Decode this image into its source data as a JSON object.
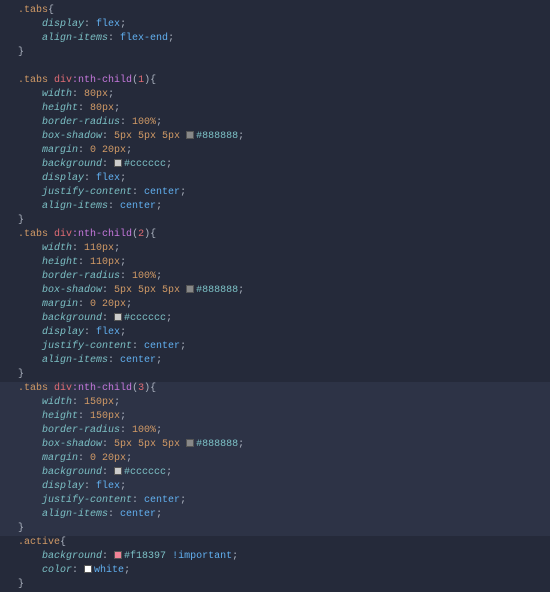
{
  "selectors": {
    "tabs": ".tabs",
    "tabs_div": ".tabs div",
    "nth": ":nth-child",
    "n1": "1",
    "n2": "2",
    "n3": "3",
    "active": ".active"
  },
  "props": {
    "display": "display",
    "align_items": "align-items",
    "width": "width",
    "height": "height",
    "border_radius": "border-radius",
    "box_shadow": "box-shadow",
    "margin": "margin",
    "background": "background",
    "justify_content": "justify-content",
    "color": "color"
  },
  "vals": {
    "flex": "flex",
    "flex_end": "flex-end",
    "center": "center",
    "px80": "80px",
    "px110": "110px",
    "px150": "150px",
    "pct100": "100%",
    "shadow": "5px 5px 5px ",
    "margin020": "0 20px",
    "hex888": "#888888",
    "hexccc": "#cccccc",
    "hexf18": "#f18397",
    "white": "white",
    "important": " !important"
  },
  "punct": {
    "ob": "{",
    "cb": "}",
    "op": "(",
    "cp": ")",
    "colon": ": ",
    "semi": ";",
    "sp": " "
  },
  "div_kw": "div",
  "swatches": {
    "g888": "#888888",
    "gccc": "#cccccc",
    "f18": "#f18397",
    "white": "#ffffff"
  }
}
